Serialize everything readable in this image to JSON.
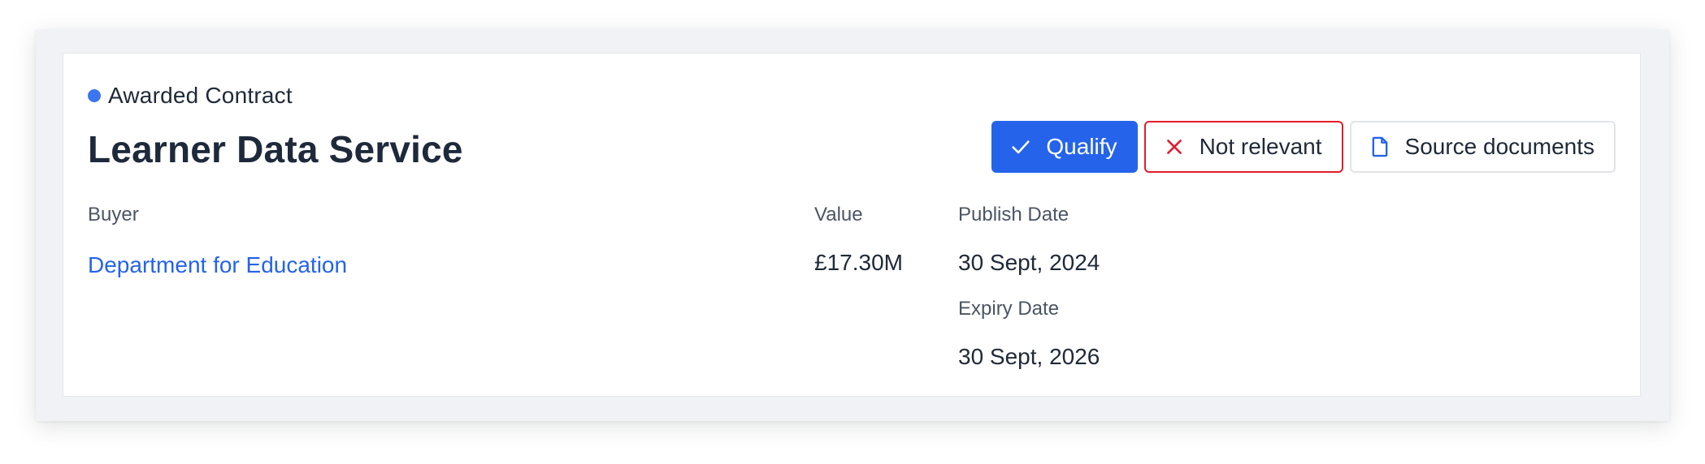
{
  "card": {
    "status": {
      "label": "Awarded Contract",
      "dot_color": "#3b75ef"
    },
    "title": "Learner Data Service",
    "actions": {
      "qualify": {
        "label": "Qualify",
        "icon": "check-icon"
      },
      "not_relevant": {
        "label": "Not relevant",
        "icon": "close-icon"
      },
      "source_documents": {
        "label": "Source documents",
        "icon": "document-icon"
      }
    },
    "fields": {
      "buyer": {
        "label": "Buyer",
        "value": "Department for Education"
      },
      "value": {
        "label": "Value",
        "value": "£17.30M"
      },
      "publish_date": {
        "label": "Publish Date",
        "value": "30 Sept, 2024"
      },
      "expiry_date": {
        "label": "Expiry Date",
        "value": "30 Sept, 2026"
      }
    }
  },
  "colors": {
    "accent": "#2563eb",
    "danger": "#e11d2e",
    "title": "#1e293b"
  }
}
